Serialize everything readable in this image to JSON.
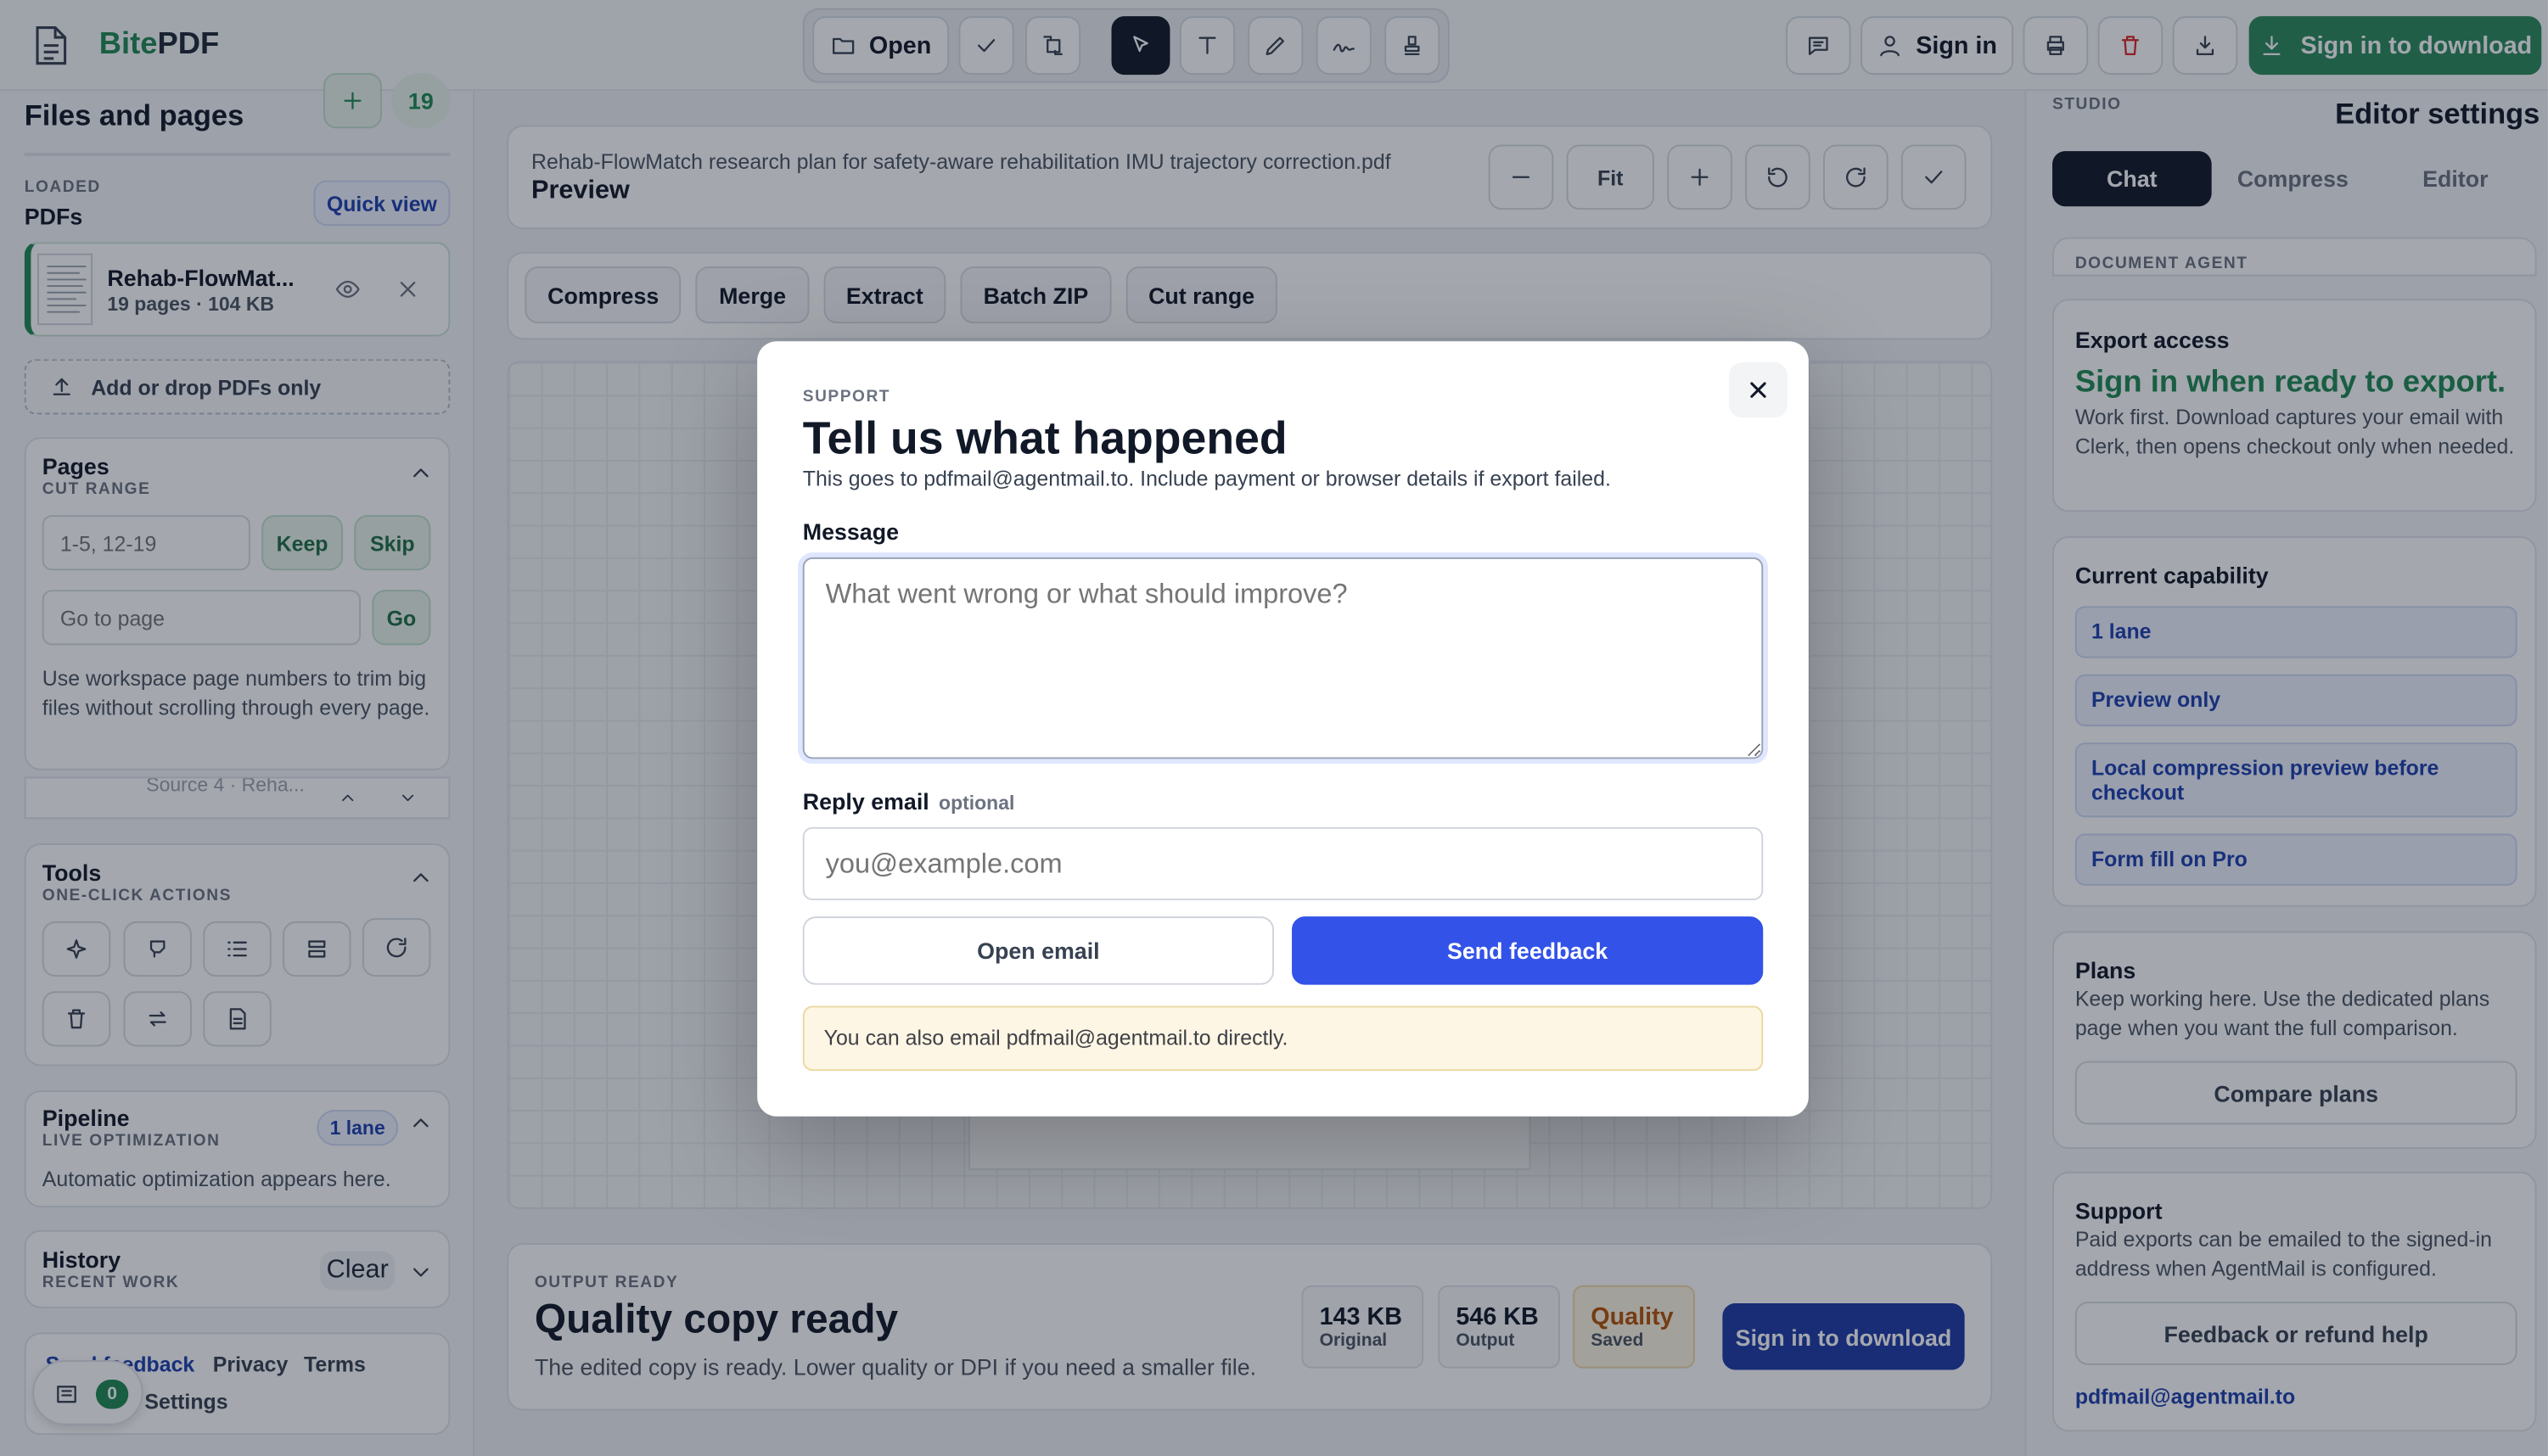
{
  "app": {
    "name_prefix": "Bite",
    "name_suffix": "PDF"
  },
  "toolbar": {
    "open_label": "Open",
    "sign_in_label": "Sign in",
    "sign_in_download_label": "Sign in to download"
  },
  "left": {
    "files_title": "Files and pages",
    "add_count": "19",
    "loaded_label": "LOADED",
    "pdfs_label": "PDFs",
    "quick_view_label": "Quick view",
    "file": {
      "name": "Rehab-FlowMat...",
      "meta": "19 pages · 104 KB"
    },
    "add_drop_label": "Add or drop PDFs only",
    "pages": {
      "title": "Pages",
      "subtitle": "CUT RANGE",
      "range_placeholder": "1-5, 12-19",
      "keep_label": "Keep",
      "skip_label": "Skip",
      "goto_placeholder": "Go to page",
      "go_label": "Go",
      "help": "Use workspace page numbers to trim big files without scrolling through every page.",
      "source_row": "Source 4 · Reha..."
    },
    "tools": {
      "title": "Tools",
      "subtitle": "ONE-CLICK ACTIONS"
    },
    "pipeline": {
      "title": "Pipeline",
      "subtitle": "LIVE OPTIMIZATION",
      "badge": "1 lane",
      "text": "Automatic optimization appears here."
    },
    "history": {
      "title": "History",
      "subtitle": "RECENT WORK",
      "clear_label": "Clear"
    },
    "footer": {
      "feedback_label": "Send feedback",
      "privacy_label": "Privacy",
      "terms_label": "Terms",
      "settings_label": "Settings",
      "notif_count": "0"
    }
  },
  "center": {
    "filename": "Rehab-FlowMatch research plan for safety-aware rehabilitation IMU trajectory correction.pdf",
    "preview_label": "Preview",
    "fit_label": "Fit",
    "actions": [
      "Compress",
      "Merge",
      "Extract",
      "Batch ZIP",
      "Cut range"
    ],
    "output": {
      "eyebrow": "OUTPUT READY",
      "title": "Quality copy ready",
      "desc": "The edited copy is ready. Lower quality or DPI if you need a smaller file.",
      "original_value": "143 KB",
      "original_label": "Original",
      "output_value": "546 KB",
      "output_label": "Output",
      "quality_value": "Quality",
      "quality_label": "Saved",
      "download_label": "Sign in to download"
    }
  },
  "right": {
    "studio_label": "STUDIO",
    "title": "Editor settings",
    "tabs": [
      "Chat",
      "Compress",
      "Editor"
    ],
    "agent_label": "DOCUMENT AGENT",
    "export": {
      "title": "Export access",
      "headline": "Sign in when ready to export.",
      "text": "Work first. Download captures your email with Clerk, then opens checkout only when needed."
    },
    "capability": {
      "title": "Current capability",
      "items": [
        "1 lane",
        "Preview only",
        "Local compression preview before checkout",
        "Form fill on Pro"
      ]
    },
    "plans": {
      "title": "Plans",
      "text": "Keep working here. Use the dedicated plans page when you want the full comparison.",
      "compare_label": "Compare plans"
    },
    "support": {
      "title": "Support",
      "text": "Paid exports can be emailed to the signed-in address when AgentMail is configured.",
      "help_label": "Feedback or refund help",
      "email": "pdfmail@agentmail.to"
    }
  },
  "modal": {
    "eyebrow": "SUPPORT",
    "title": "Tell us what happened",
    "desc": "This goes to pdfmail@agentmail.to. Include payment or browser details if export failed.",
    "message_label": "Message",
    "message_placeholder": "What went wrong or what should improve?",
    "reply_label": "Reply email",
    "optional_label": "optional",
    "reply_placeholder": "you@example.com",
    "open_email_label": "Open email",
    "send_label": "Send feedback",
    "note": "You can also email pdfmail@agentmail.to directly."
  },
  "colors": {
    "accent": "#3352e8",
    "green": "#1f8a55",
    "navy": "#1e3aa6",
    "amber": "#b45309"
  }
}
